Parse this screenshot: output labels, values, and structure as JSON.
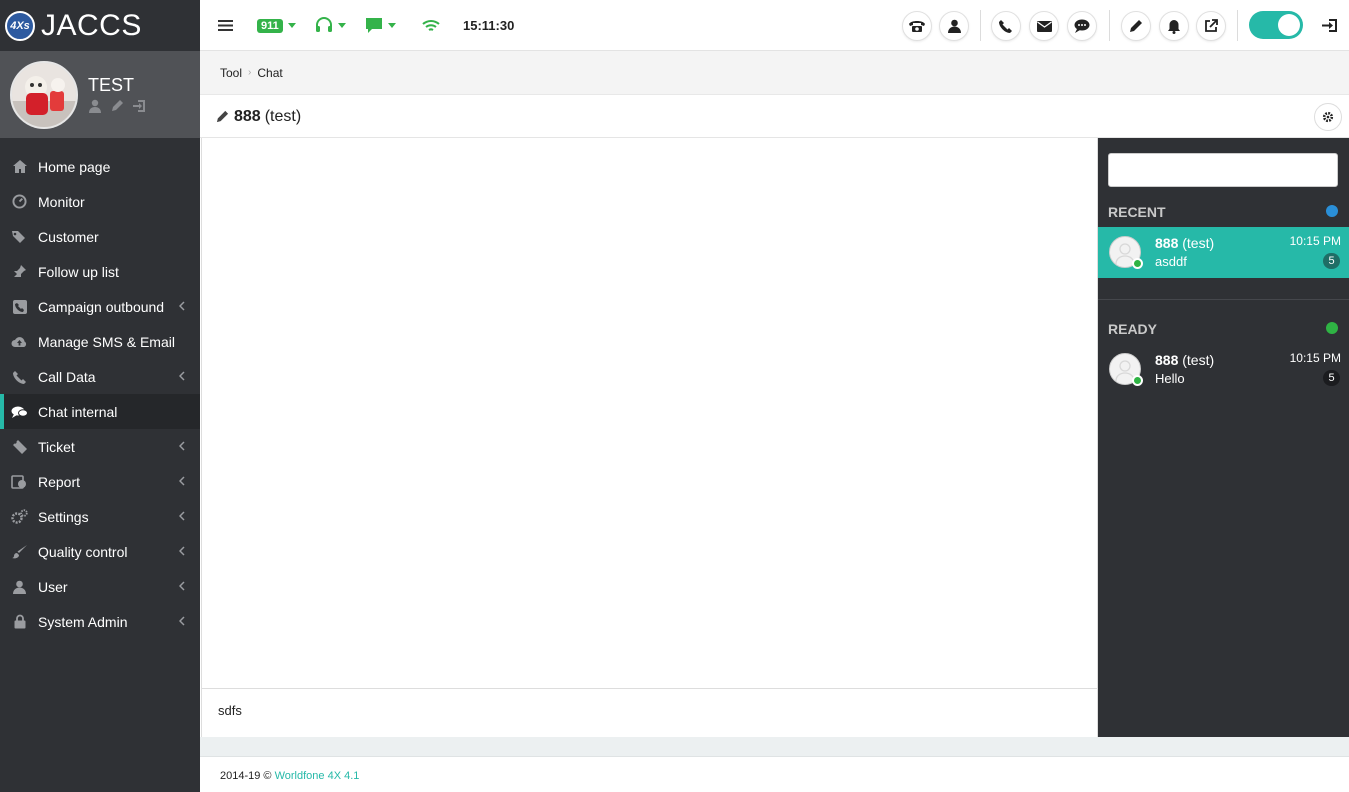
{
  "app": {
    "brand": "JACCS",
    "logo_badge": "4Xs"
  },
  "profile": {
    "name": "TEST"
  },
  "menu": [
    {
      "label": "Home page",
      "icon": "home-icon",
      "has_sub": false
    },
    {
      "label": "Monitor",
      "icon": "dashboard-icon",
      "has_sub": false
    },
    {
      "label": "Customer",
      "icon": "tags-icon",
      "has_sub": false
    },
    {
      "label": "Follow up list",
      "icon": "pin-icon",
      "has_sub": false
    },
    {
      "label": "Campaign outbound",
      "icon": "phone-square-icon",
      "has_sub": true
    },
    {
      "label": "Manage SMS & Email",
      "icon": "cloud-upload-icon",
      "has_sub": false
    },
    {
      "label": "Call Data",
      "icon": "phone-icon",
      "has_sub": true
    },
    {
      "label": "Chat internal",
      "icon": "comments-icon",
      "has_sub": false,
      "active": true
    },
    {
      "label": "Ticket",
      "icon": "ticket-icon",
      "has_sub": true
    },
    {
      "label": "Report",
      "icon": "report-icon",
      "has_sub": true
    },
    {
      "label": "Settings",
      "icon": "cogs-icon",
      "has_sub": true
    },
    {
      "label": "Quality control",
      "icon": "brush-icon",
      "has_sub": true
    },
    {
      "label": "User",
      "icon": "user-icon",
      "has_sub": true
    },
    {
      "label": "System Admin",
      "icon": "lock-icon",
      "has_sub": true
    }
  ],
  "topbar": {
    "badge_911": "911",
    "clock": "15:11:30"
  },
  "breadcrumb": {
    "items": [
      "Tool",
      "Chat"
    ]
  },
  "chat": {
    "title_bold": "888",
    "title_rest": "(test)",
    "input_value": "sdfs"
  },
  "contacts": {
    "recent_label": "RECENT",
    "ready_label": "READY",
    "recent": [
      {
        "name": "888",
        "suffix": "(test)",
        "message": "asddf",
        "time": "10:15 PM",
        "count": "5"
      }
    ],
    "ready": [
      {
        "name": "888",
        "suffix": "(test)",
        "message": "Hello",
        "time": "10:15 PM",
        "count": "5"
      }
    ]
  },
  "footer": {
    "copyright": "2014-19 ©",
    "link": "Worldfone 4X 4.1"
  },
  "colors": {
    "accent": "#26b9a8",
    "sidebar": "#2f3135",
    "green": "#2fb344",
    "blue": "#2a8fd8"
  }
}
